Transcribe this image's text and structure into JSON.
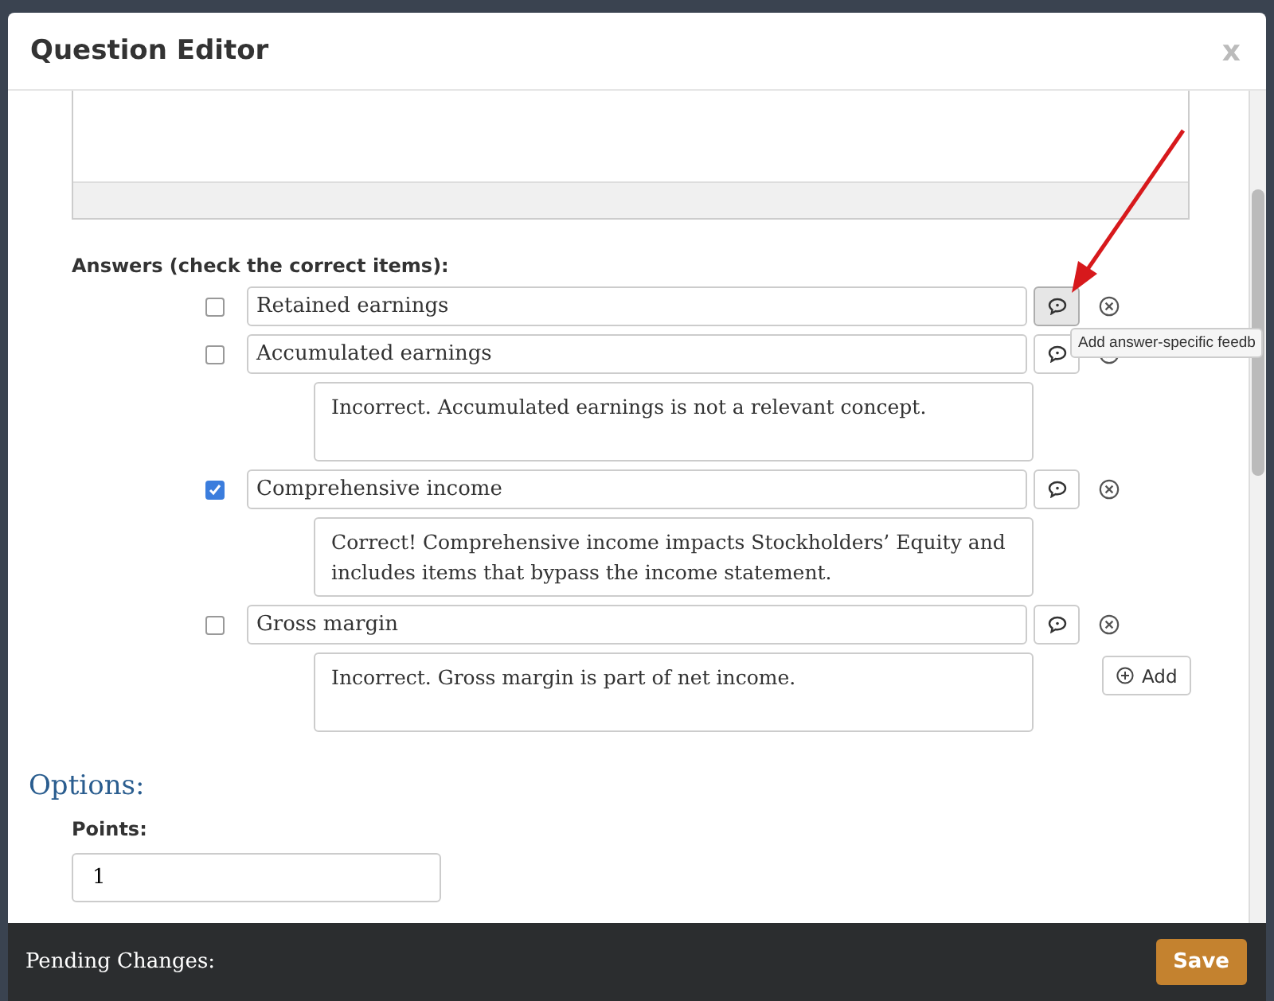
{
  "dialog": {
    "title": "Question Editor",
    "close": "x"
  },
  "answers_label": "Answers (check the correct items):",
  "answers": [
    {
      "text": "Retained earnings",
      "checked": false,
      "hovered": true
    },
    {
      "text": "Accumulated earnings",
      "checked": false,
      "hovered": false,
      "feedback": "Incorrect. Accumulated earnings is not a relevant concept."
    },
    {
      "text": "Comprehensive income",
      "checked": true,
      "hovered": false,
      "feedback": "Correct! Comprehensive income impacts Stockholders’  Equity and includes items that bypass the income statement."
    },
    {
      "text": "Gross margin",
      "checked": false,
      "hovered": false,
      "feedback": "Incorrect. Gross margin is part of net income."
    }
  ],
  "tooltip": "Add answer-specific feedb",
  "add_button": "Add",
  "options": {
    "heading": "Options:",
    "points_label": "Points:",
    "points_value": "1"
  },
  "footer": {
    "status": "Pending Changes:",
    "save": "Save"
  }
}
